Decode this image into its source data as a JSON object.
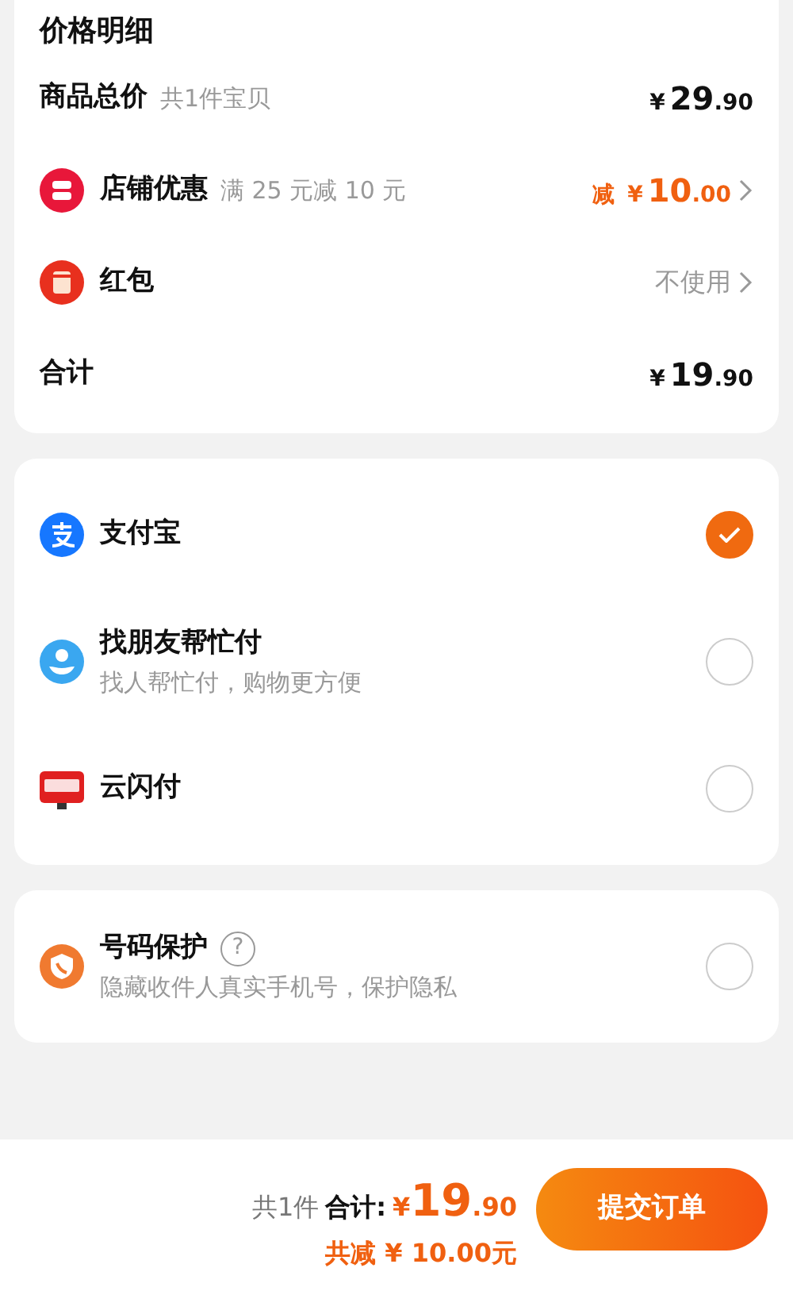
{
  "price_details": {
    "title": "价格明细",
    "rows": [
      {
        "kind": "subtotal",
        "label": "商品总价",
        "note": "共1件宝贝",
        "price": {
          "currency": "¥",
          "int": "29",
          "dec": ".90"
        }
      },
      {
        "kind": "discount",
        "label": "店铺优惠",
        "note": "满 25 元减 10 元",
        "price": {
          "prefix": "减",
          "currency": "¥",
          "int": "10",
          "dec": ".00"
        }
      },
      {
        "kind": "voucher",
        "label": "红包",
        "value": "不使用"
      },
      {
        "kind": "total",
        "label": "合计",
        "price": {
          "currency": "¥",
          "int": "19",
          "dec": ".90"
        }
      }
    ]
  },
  "payment_methods": [
    {
      "label": "支付宝",
      "selected": true
    },
    {
      "label": "找朋友帮忙付",
      "subtitle": "找人帮忙付，购物更方便",
      "selected": false
    },
    {
      "label": "云闪付",
      "selected": false
    }
  ],
  "number_protection": {
    "label": "号码保护",
    "help": "?",
    "subtitle": "隐藏收件人真实手机号，保护隐私",
    "checked": false
  },
  "footer": {
    "count": "共1件",
    "total_label": "合计:",
    "total": {
      "currency": "¥",
      "int": "19",
      "dec": ".90"
    },
    "discount": "共减 ¥ 10.00元",
    "button": "提交订单"
  }
}
